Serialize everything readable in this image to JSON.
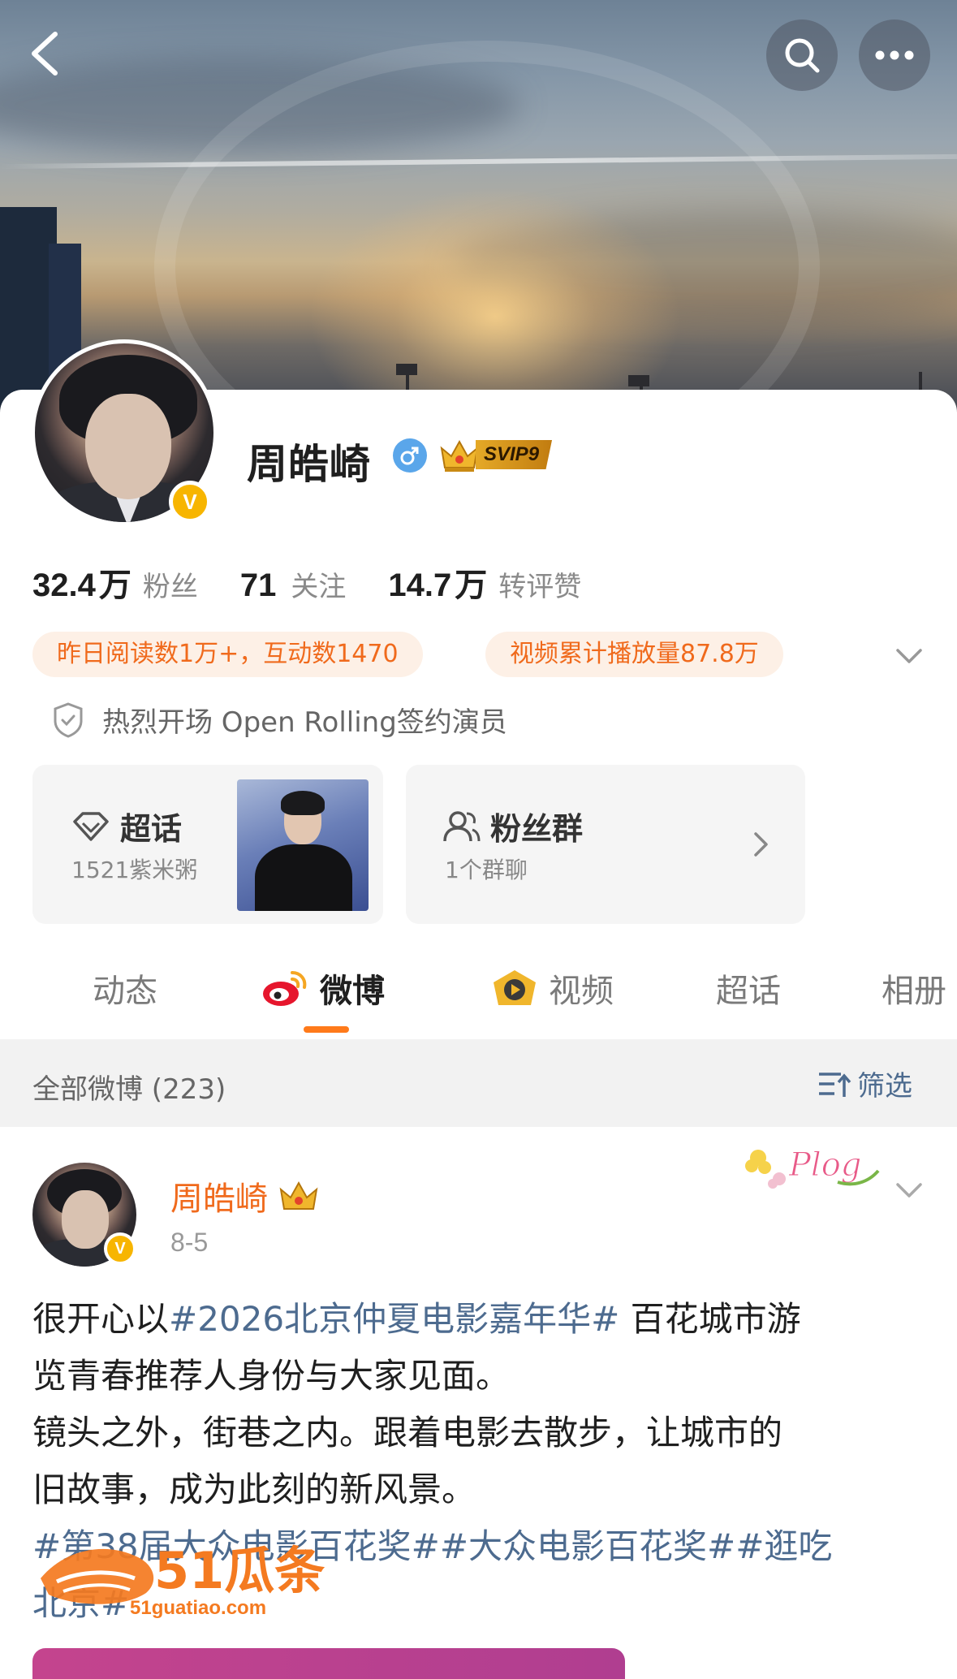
{
  "profile": {
    "name": "周皓崎",
    "vip_label": "SVIP9",
    "verified_mark": "V",
    "stats": [
      {
        "num": "32.4",
        "unit": "万",
        "label": "粉丝"
      },
      {
        "num": "71",
        "unit": "",
        "label": "关注"
      },
      {
        "num": "14.7",
        "unit": "万",
        "label": "转评赞"
      }
    ],
    "pills": [
      "昨日阅读数1万+，互动数1470",
      "视频累计播放量87.8万"
    ],
    "cert": "热烈开场 Open Rolling签约演员"
  },
  "chaohua": {
    "title": "超话",
    "sub": "1521紫米粥"
  },
  "fan_group": {
    "title": "粉丝群",
    "sub": "1个群聊"
  },
  "tabs": [
    "动态",
    "微博",
    "视频",
    "超话",
    "相册"
  ],
  "active_tab": "微博",
  "filterbar": {
    "count": "全部微博 (223)",
    "filter": "筛选"
  },
  "post": {
    "author": "周皓崎",
    "date": "8-5",
    "plog": "Plog",
    "lines": [
      {
        "pre": "很开心以",
        "tag": "#2026北京仲夏电影嘉年华#",
        "post": " 百花城市游"
      },
      {
        "pre": "览青春推荐人身份与大家见面。",
        "tag": "",
        "post": ""
      },
      {
        "pre": "镜头之外，街巷之内。跟着电影去散步，让城市的",
        "tag": "",
        "post": ""
      },
      {
        "pre": "旧故事，成为此刻的新风景。",
        "tag": "",
        "post": ""
      },
      {
        "pre": "",
        "tag": "#第38届大众电影百花奖##大众电影百花奖##逛吃",
        "post": ""
      },
      {
        "pre": "",
        "tag": "北京#",
        "post": ""
      }
    ]
  },
  "watermark": {
    "brand": "51瓜条",
    "url": "51guatiao.com"
  },
  "colors": {
    "accent": "#ff7a1a",
    "link": "#4d6b8f",
    "pill_bg": "#fdf0e6",
    "pill_text": "#f06a1c",
    "vip_gold": "#e5a927"
  },
  "icons": [
    "back-icon",
    "search-icon",
    "more-icon",
    "male-icon",
    "crown-icon",
    "shield-icon",
    "chevron-down-icon",
    "diamond-icon",
    "group-icon",
    "chevron-right-icon",
    "weibo-icon",
    "video-icon",
    "filter-icon"
  ]
}
